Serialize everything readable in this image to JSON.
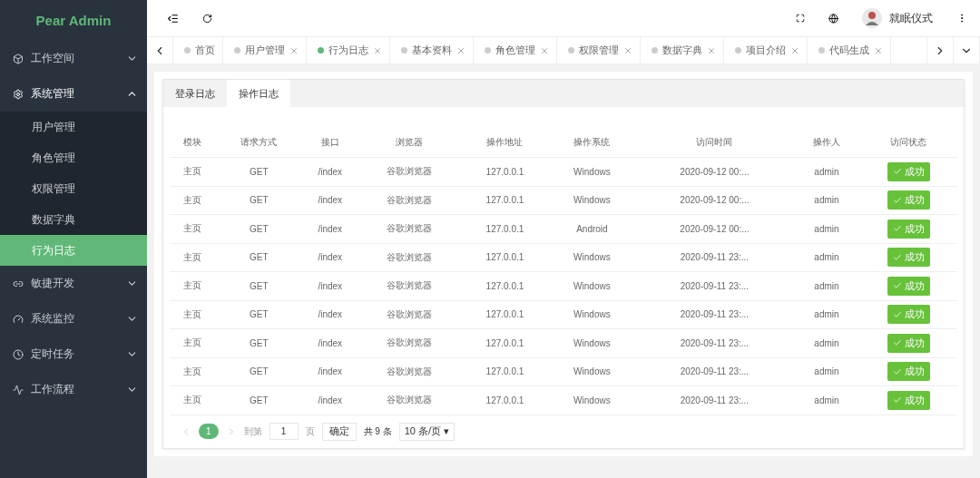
{
  "logo": "Pear Admin",
  "sidebar": {
    "items": [
      {
        "label": "工作空间",
        "expanded": false
      },
      {
        "label": "系统管理",
        "expanded": true,
        "children": [
          {
            "label": "用户管理",
            "selected": false
          },
          {
            "label": "角色管理",
            "selected": false
          },
          {
            "label": "权限管理",
            "selected": false
          },
          {
            "label": "数据字典",
            "selected": false
          },
          {
            "label": "行为日志",
            "selected": true
          }
        ]
      },
      {
        "label": "敏捷开发",
        "expanded": false
      },
      {
        "label": "系统监控",
        "expanded": false
      },
      {
        "label": "定时任务",
        "expanded": false
      },
      {
        "label": "工作流程",
        "expanded": false
      }
    ]
  },
  "header": {
    "username": "就眠仪式"
  },
  "page_tabs": [
    {
      "label": "首页",
      "selected": false,
      "closable": false
    },
    {
      "label": "用户管理",
      "selected": false,
      "closable": true
    },
    {
      "label": "行为日志",
      "selected": true,
      "closable": true
    },
    {
      "label": "基本资料",
      "selected": false,
      "closable": true
    },
    {
      "label": "角色管理",
      "selected": false,
      "closable": true
    },
    {
      "label": "权限管理",
      "selected": false,
      "closable": true
    },
    {
      "label": "数据字典",
      "selected": false,
      "closable": true
    },
    {
      "label": "项目介绍",
      "selected": false,
      "closable": true
    },
    {
      "label": "代码生成",
      "selected": false,
      "closable": true
    }
  ],
  "log_tabs": [
    {
      "label": "登录日志",
      "selected": false
    },
    {
      "label": "操作日志",
      "selected": true
    }
  ],
  "table": {
    "columns": [
      "模块",
      "请求方式",
      "接口",
      "浏览器",
      "操作地址",
      "操作系统",
      "访问时间",
      "操作人",
      "访问状态"
    ],
    "rows": [
      [
        "主页",
        "GET",
        "/index",
        "谷歌浏览器",
        "127.0.0.1",
        "Windows",
        "2020-09-12 00:...",
        "admin",
        "成功"
      ],
      [
        "主页",
        "GET",
        "/index",
        "谷歌浏览器",
        "127.0.0.1",
        "Windows",
        "2020-09-12 00:...",
        "admin",
        "成功"
      ],
      [
        "主页",
        "GET",
        "/index",
        "谷歌浏览器",
        "127.0.0.1",
        "Android",
        "2020-09-12 00:...",
        "admin",
        "成功"
      ],
      [
        "主页",
        "GET",
        "/index",
        "谷歌浏览器",
        "127.0.0.1",
        "Windows",
        "2020-09-11 23:...",
        "admin",
        "成功"
      ],
      [
        "主页",
        "GET",
        "/index",
        "谷歌浏览器",
        "127.0.0.1",
        "Windows",
        "2020-09-11 23:...",
        "admin",
        "成功"
      ],
      [
        "主页",
        "GET",
        "/index",
        "谷歌浏览器",
        "127.0.0.1",
        "Windows",
        "2020-09-11 23:...",
        "admin",
        "成功"
      ],
      [
        "主页",
        "GET",
        "/index",
        "谷歌浏览器",
        "127.0.0.1",
        "Windows",
        "2020-09-11 23:...",
        "admin",
        "成功"
      ],
      [
        "主页",
        "GET",
        "/index",
        "谷歌浏览器",
        "127.0.0.1",
        "Windows",
        "2020-09-11 23:...",
        "admin",
        "成功"
      ],
      [
        "主页",
        "GET",
        "/index",
        "谷歌浏览器",
        "127.0.0.1",
        "Windows",
        "2020-09-11 23:...",
        "admin",
        "成功"
      ]
    ]
  },
  "pagination": {
    "page": "1",
    "goto_label": "到第",
    "goto_value": "1",
    "page_unit": "页",
    "confirm": "确定",
    "total": "共 9 条",
    "page_size": "10 条/页 ▾"
  }
}
